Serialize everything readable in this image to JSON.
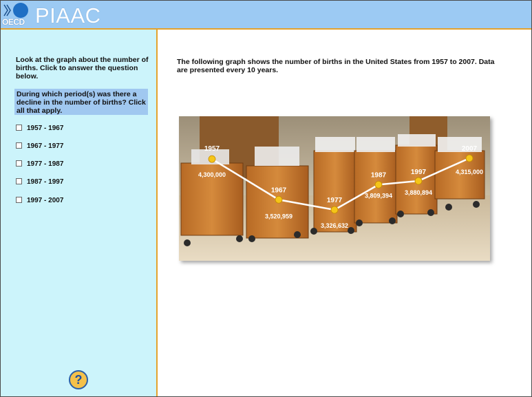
{
  "header": {
    "logo_text": "OECD",
    "brand": "PIAAC",
    "header_color": "#9ccaf3",
    "accent": "#e4a22c"
  },
  "sidebar": {
    "instruction": "Look at the graph about the number of births. Click to answer the question below.",
    "question": "During which period(s) was there a decline in the number of births? Click all that apply.",
    "options": [
      {
        "label": "1957 - 1967",
        "checked": false
      },
      {
        "label": "1967 - 1977",
        "checked": false
      },
      {
        "label": "1977 - 1987",
        "checked": false
      },
      {
        "label": "1987 - 1997",
        "checked": false
      },
      {
        "label": "1997 - 2007",
        "checked": false
      }
    ],
    "help_icon": "question-mark-icon",
    "help_label": "?"
  },
  "main": {
    "prompt": "The following graph shows the number of births in the United States from 1957 to 2007. Data are presented every 10 years."
  },
  "chart_data": {
    "type": "line",
    "x": [
      "1957",
      "1967",
      "1977",
      "1987",
      "1997",
      "2007"
    ],
    "values": [
      4300000,
      3520959,
      3326632,
      3809394,
      3880894,
      4315000
    ],
    "value_labels": [
      "4,300,000",
      "3,520,959",
      "3,326,632",
      "3,809,394",
      "3,880,894",
      "4,315,000"
    ],
    "line_color": "#ffffff",
    "point_color": "#f5c518",
    "background": "photo of hospital nursery bassinets"
  }
}
